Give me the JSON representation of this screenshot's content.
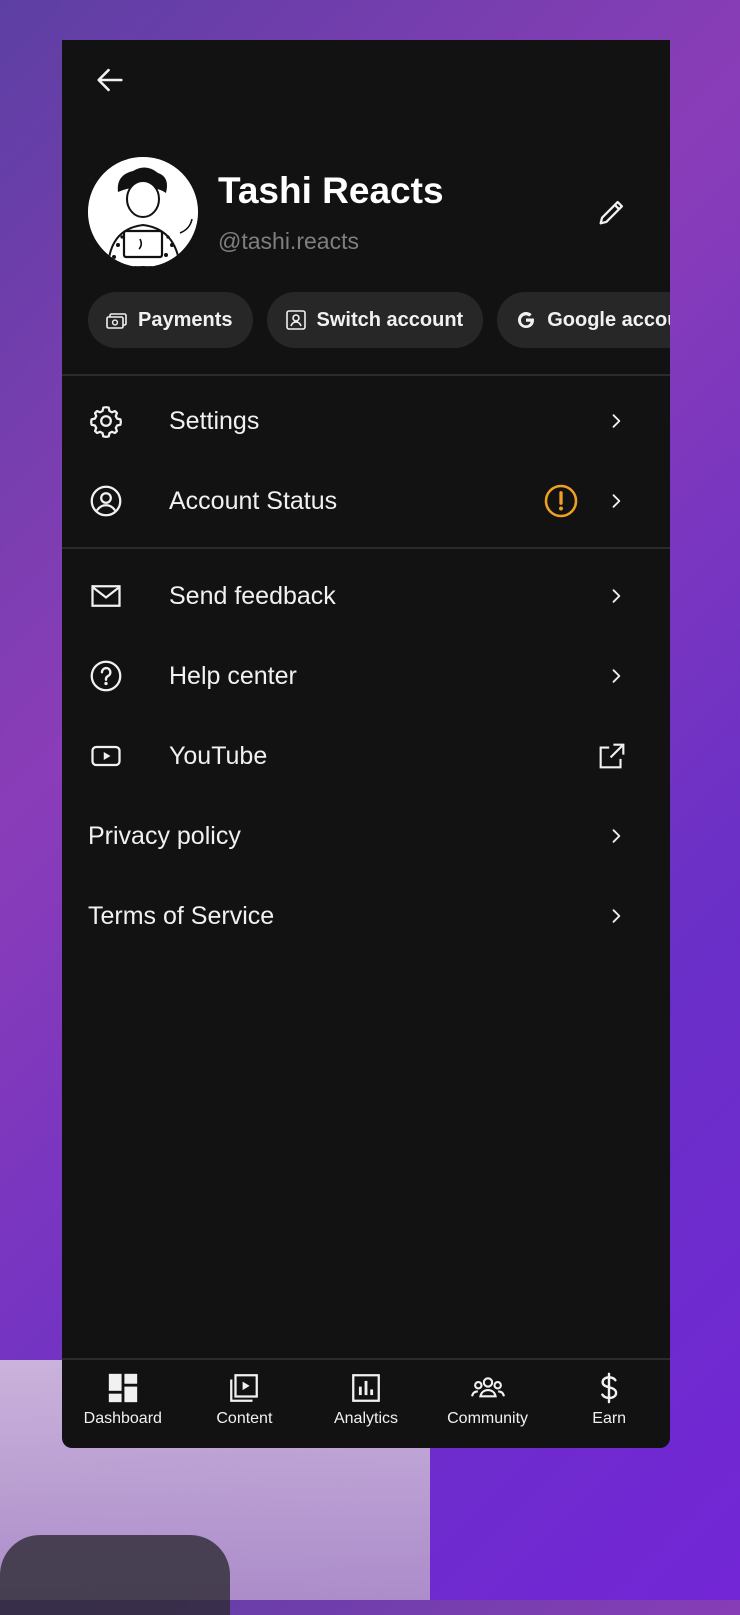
{
  "profile": {
    "name": "Tashi Reacts",
    "handle": "@tashi.reacts"
  },
  "chips": [
    {
      "label": "Payments",
      "icon": "payments-icon"
    },
    {
      "label": "Switch account",
      "icon": "switch-account-icon"
    },
    {
      "label": "Google account",
      "icon": "google-icon"
    }
  ],
  "menu": {
    "settings": "Settings",
    "account_status": "Account Status",
    "send_feedback": "Send feedback",
    "help_center": "Help center",
    "youtube": "YouTube",
    "privacy_policy": "Privacy policy",
    "terms_of_service": "Terms of Service"
  },
  "bottom_nav": [
    {
      "label": "Dashboard",
      "icon": "dashboard-icon"
    },
    {
      "label": "Content",
      "icon": "content-icon"
    },
    {
      "label": "Analytics",
      "icon": "analytics-icon"
    },
    {
      "label": "Community",
      "icon": "community-icon"
    },
    {
      "label": "Earn",
      "icon": "earn-icon"
    }
  ],
  "colors": {
    "background": "#121212",
    "chip_background": "#272727",
    "warning": "#f0a020",
    "text": "#f1f1f1",
    "muted_text": "#7f7f7f"
  }
}
